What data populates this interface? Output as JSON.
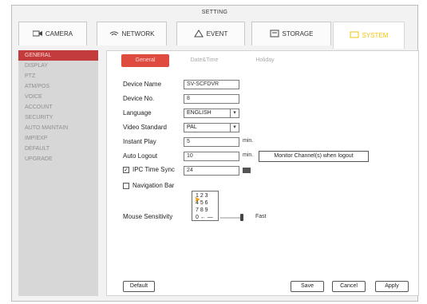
{
  "window": {
    "title": "SETTING"
  },
  "tabs": [
    {
      "label": "CAMERA",
      "icon": "camera-icon"
    },
    {
      "label": "NETWORK",
      "icon": "network-icon"
    },
    {
      "label": "EVENT",
      "icon": "event-icon"
    },
    {
      "label": "STORAGE",
      "icon": "storage-icon"
    },
    {
      "label": "SYSTEM",
      "icon": "system-icon",
      "active": true
    }
  ],
  "sidebar": {
    "items": [
      {
        "label": "GENERAL",
        "active": true
      },
      {
        "label": "DISPLAY"
      },
      {
        "label": "PTZ"
      },
      {
        "label": "ATM/POS"
      },
      {
        "label": "VOICE"
      },
      {
        "label": "ACCOUNT"
      },
      {
        "label": "SECURITY"
      },
      {
        "label": "AUTO MAINTAIN"
      },
      {
        "label": "IMP/EXP"
      },
      {
        "label": "DEFAULT"
      },
      {
        "label": "UPGRADE"
      }
    ]
  },
  "subtabs": [
    {
      "label": "General",
      "active": true
    },
    {
      "label": "Date&Time"
    },
    {
      "label": "Holiday"
    }
  ],
  "form": {
    "device_name": {
      "label": "Device Name",
      "value": "SV-SCFDVR"
    },
    "device_no": {
      "label": "Device No.",
      "value": "8"
    },
    "language": {
      "label": "Language",
      "value": "ENGLISH"
    },
    "video_standard": {
      "label": "Video Standard",
      "value": "PAL"
    },
    "instant_play": {
      "label": "Instant Play",
      "value": "5",
      "unit": "min."
    },
    "auto_logout": {
      "label": "Auto Logout",
      "value": "10",
      "unit": "min.",
      "extra": "Monitor Channel(s) when logout"
    },
    "ipc_time_sync": {
      "label": "IPC Time Sync",
      "value": "24",
      "checked": true
    },
    "navigation_bar": {
      "label": "Navigation Bar",
      "checked": false
    },
    "mouse_sensitivity": {
      "label": "Mouse Sensitivity",
      "right": "Fast"
    }
  },
  "popup": {
    "rows": [
      "1  2  3",
      "4  5  6",
      "7  8  9",
      "0  ←  —"
    ]
  },
  "buttons": {
    "default": "Default",
    "save": "Save",
    "cancel": "Cancel",
    "apply": "Apply"
  },
  "colors": {
    "accent": "#c43b3b",
    "tab_active_text": "#f1c40f"
  }
}
